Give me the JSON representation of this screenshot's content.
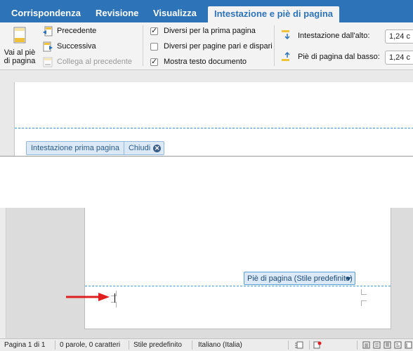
{
  "tabs": [
    "Corrispondenza",
    "Revisione",
    "Visualizza",
    "Intestazione e piè di pagina"
  ],
  "active_tab": "Intestazione e piè di pagina",
  "ribbon": {
    "goto_footer_line1": "Vai al piè",
    "goto_footer_line2": "di pagina",
    "previous": "Precedente",
    "next": "Successiva",
    "link_previous": "Collega al precedente",
    "options": [
      {
        "label": "Diversi per la prima pagina",
        "checked": true
      },
      {
        "label": "Diversi per pagine pari e dispari",
        "checked": false
      },
      {
        "label": "Mostra testo documento",
        "checked": true
      }
    ],
    "header_from_top_label": "Intestazione dall'alto:",
    "header_from_top_value": "1,24 c",
    "footer_from_bottom_label": "Piè di pagina dal basso:",
    "footer_from_bottom_value": "1,24 c"
  },
  "header_tag": {
    "label": "Intestazione prima pagina",
    "close_label": "Chiudi"
  },
  "footer_tag": {
    "label": "Piè di pagina (Stile predefinito)"
  },
  "status_bar": {
    "page": "Pagina 1 di 1",
    "words": "0 parole, 0 caratteri",
    "style": "Stile predefinito",
    "language": "Italiano (Italia)"
  },
  "colors": {
    "accent": "#2d73b8",
    "guide": "#3a96cf",
    "arrow": "#e02020"
  }
}
